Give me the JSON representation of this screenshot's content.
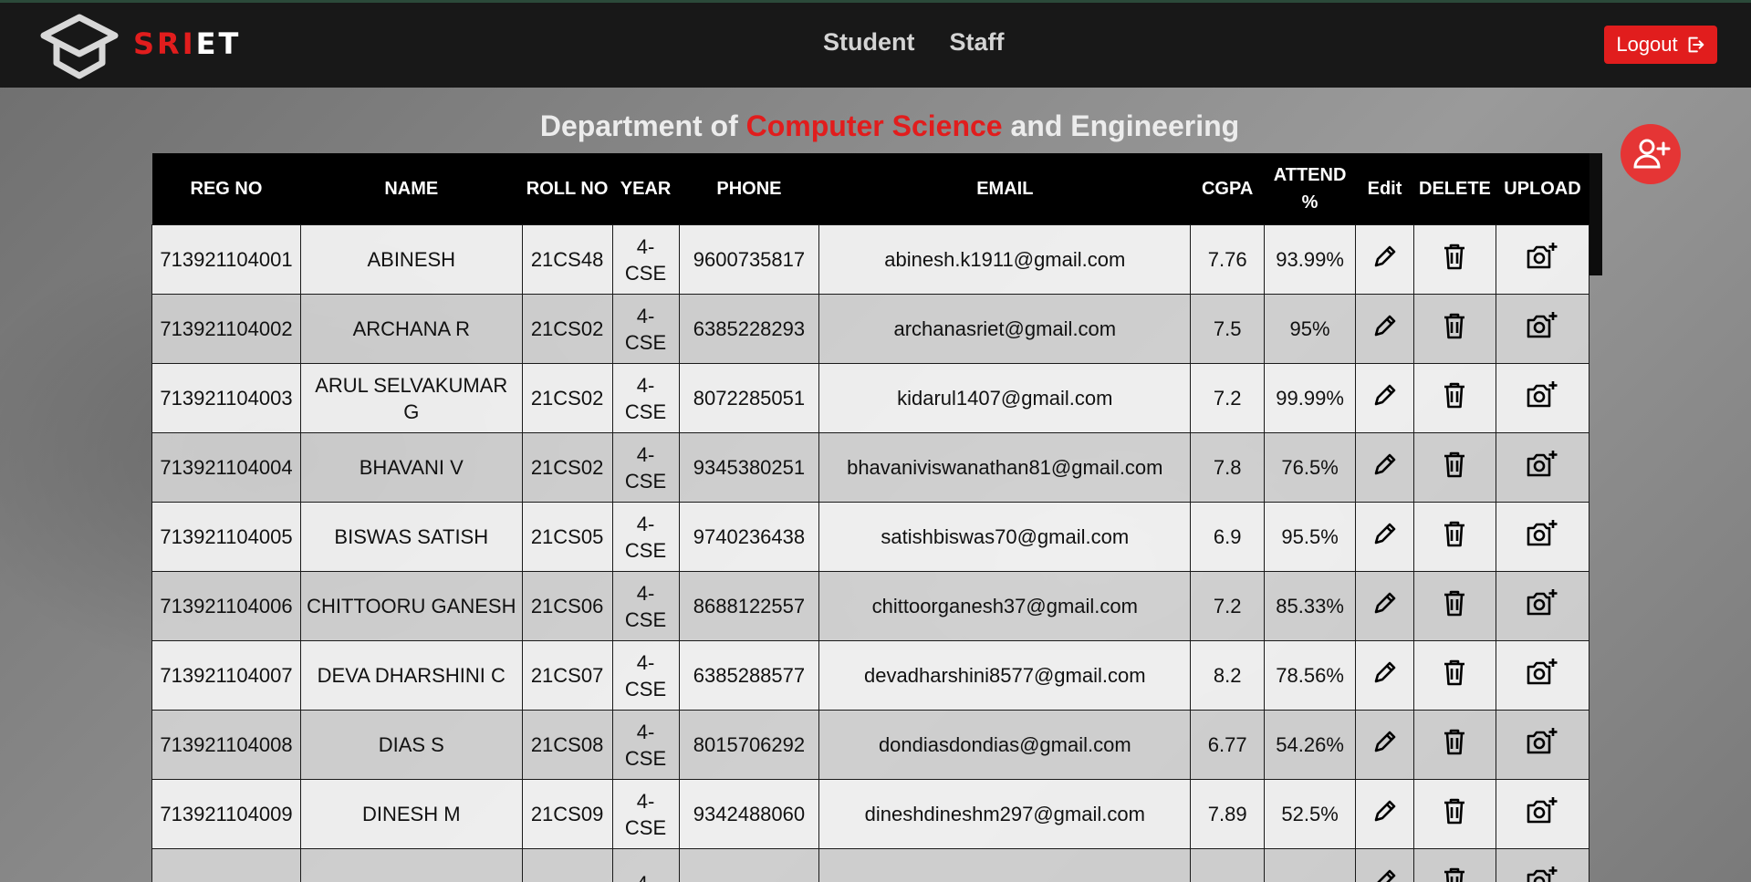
{
  "nav": {
    "brand_red": "SRI",
    "brand_white": "ET",
    "links": [
      "Student",
      "Staff"
    ],
    "logout_label": "Logout"
  },
  "heading": {
    "prefix": "Department of ",
    "highlight": "Computer Science",
    "suffix": " and Engineering"
  },
  "table": {
    "headers": [
      "REG NO",
      "NAME",
      "ROLL NO",
      "YEAR",
      "PHONE",
      "EMAIL",
      "CGPA",
      "ATTEND %",
      "Edit",
      "DELETE",
      "UPLOAD"
    ],
    "rows": [
      {
        "reg_no": "713921104001",
        "name": "ABINESH",
        "roll_no": "21CS48",
        "year": "4-CSE",
        "phone": "9600735817",
        "email": "abinesh.k1911@gmail.com",
        "cgpa": "7.76",
        "attendance": "93.99%"
      },
      {
        "reg_no": "713921104002",
        "name": "ARCHANA R",
        "roll_no": "21CS02",
        "year": "4-CSE",
        "phone": "6385228293",
        "email": "archanasriet@gmail.com",
        "cgpa": "7.5",
        "attendance": "95%"
      },
      {
        "reg_no": "713921104003",
        "name": "ARUL SELVAKUMAR G",
        "roll_no": "21CS02",
        "year": "4-CSE",
        "phone": "8072285051",
        "email": "kidarul1407@gmail.com",
        "cgpa": "7.2",
        "attendance": "99.99%"
      },
      {
        "reg_no": "713921104004",
        "name": "BHAVANI V",
        "roll_no": "21CS02",
        "year": "4-CSE",
        "phone": "9345380251",
        "email": "bhavaniviswanathan81@gmail.com",
        "cgpa": "7.8",
        "attendance": "76.5%"
      },
      {
        "reg_no": "713921104005",
        "name": "BISWAS SATISH",
        "roll_no": "21CS05",
        "year": "4-CSE",
        "phone": "9740236438",
        "email": "satishbiswas70@gmail.com",
        "cgpa": "6.9",
        "attendance": "95.5%"
      },
      {
        "reg_no": "713921104006",
        "name": "CHITTOORU GANESH",
        "roll_no": "21CS06",
        "year": "4-CSE",
        "phone": "8688122557",
        "email": "chittoorganesh37@gmail.com",
        "cgpa": "7.2",
        "attendance": "85.33%"
      },
      {
        "reg_no": "713921104007",
        "name": "DEVA DHARSHINI C",
        "roll_no": "21CS07",
        "year": "4-CSE",
        "phone": "6385288577",
        "email": "devadharshini8577@gmail.com",
        "cgpa": "8.2",
        "attendance": "78.56%"
      },
      {
        "reg_no": "713921104008",
        "name": "DIAS S",
        "roll_no": "21CS08",
        "year": "4-CSE",
        "phone": "8015706292",
        "email": "dondiasdondias@gmail.com",
        "cgpa": "6.77",
        "attendance": "54.26%"
      },
      {
        "reg_no": "713921104009",
        "name": "DINESH M",
        "roll_no": "21CS09",
        "year": "4-CSE",
        "phone": "9342488060",
        "email": "dineshdineshm297@gmail.com",
        "cgpa": "7.89",
        "attendance": "52.5%"
      },
      {
        "reg_no": "",
        "name": "",
        "roll_no": "",
        "year": "4-",
        "phone": "",
        "email": "",
        "cgpa": "",
        "attendance": ""
      }
    ]
  },
  "icons": {
    "logo": "graduation-cap-logo",
    "logout": "logout-arrow-icon",
    "add_user": "add-user-icon",
    "edit": "pencil-icon",
    "delete": "trash-icon",
    "upload": "camera-plus-icon"
  },
  "colors": {
    "accent_red": "#e11d1d",
    "navbar": "#181818",
    "table_header": "#000000"
  }
}
